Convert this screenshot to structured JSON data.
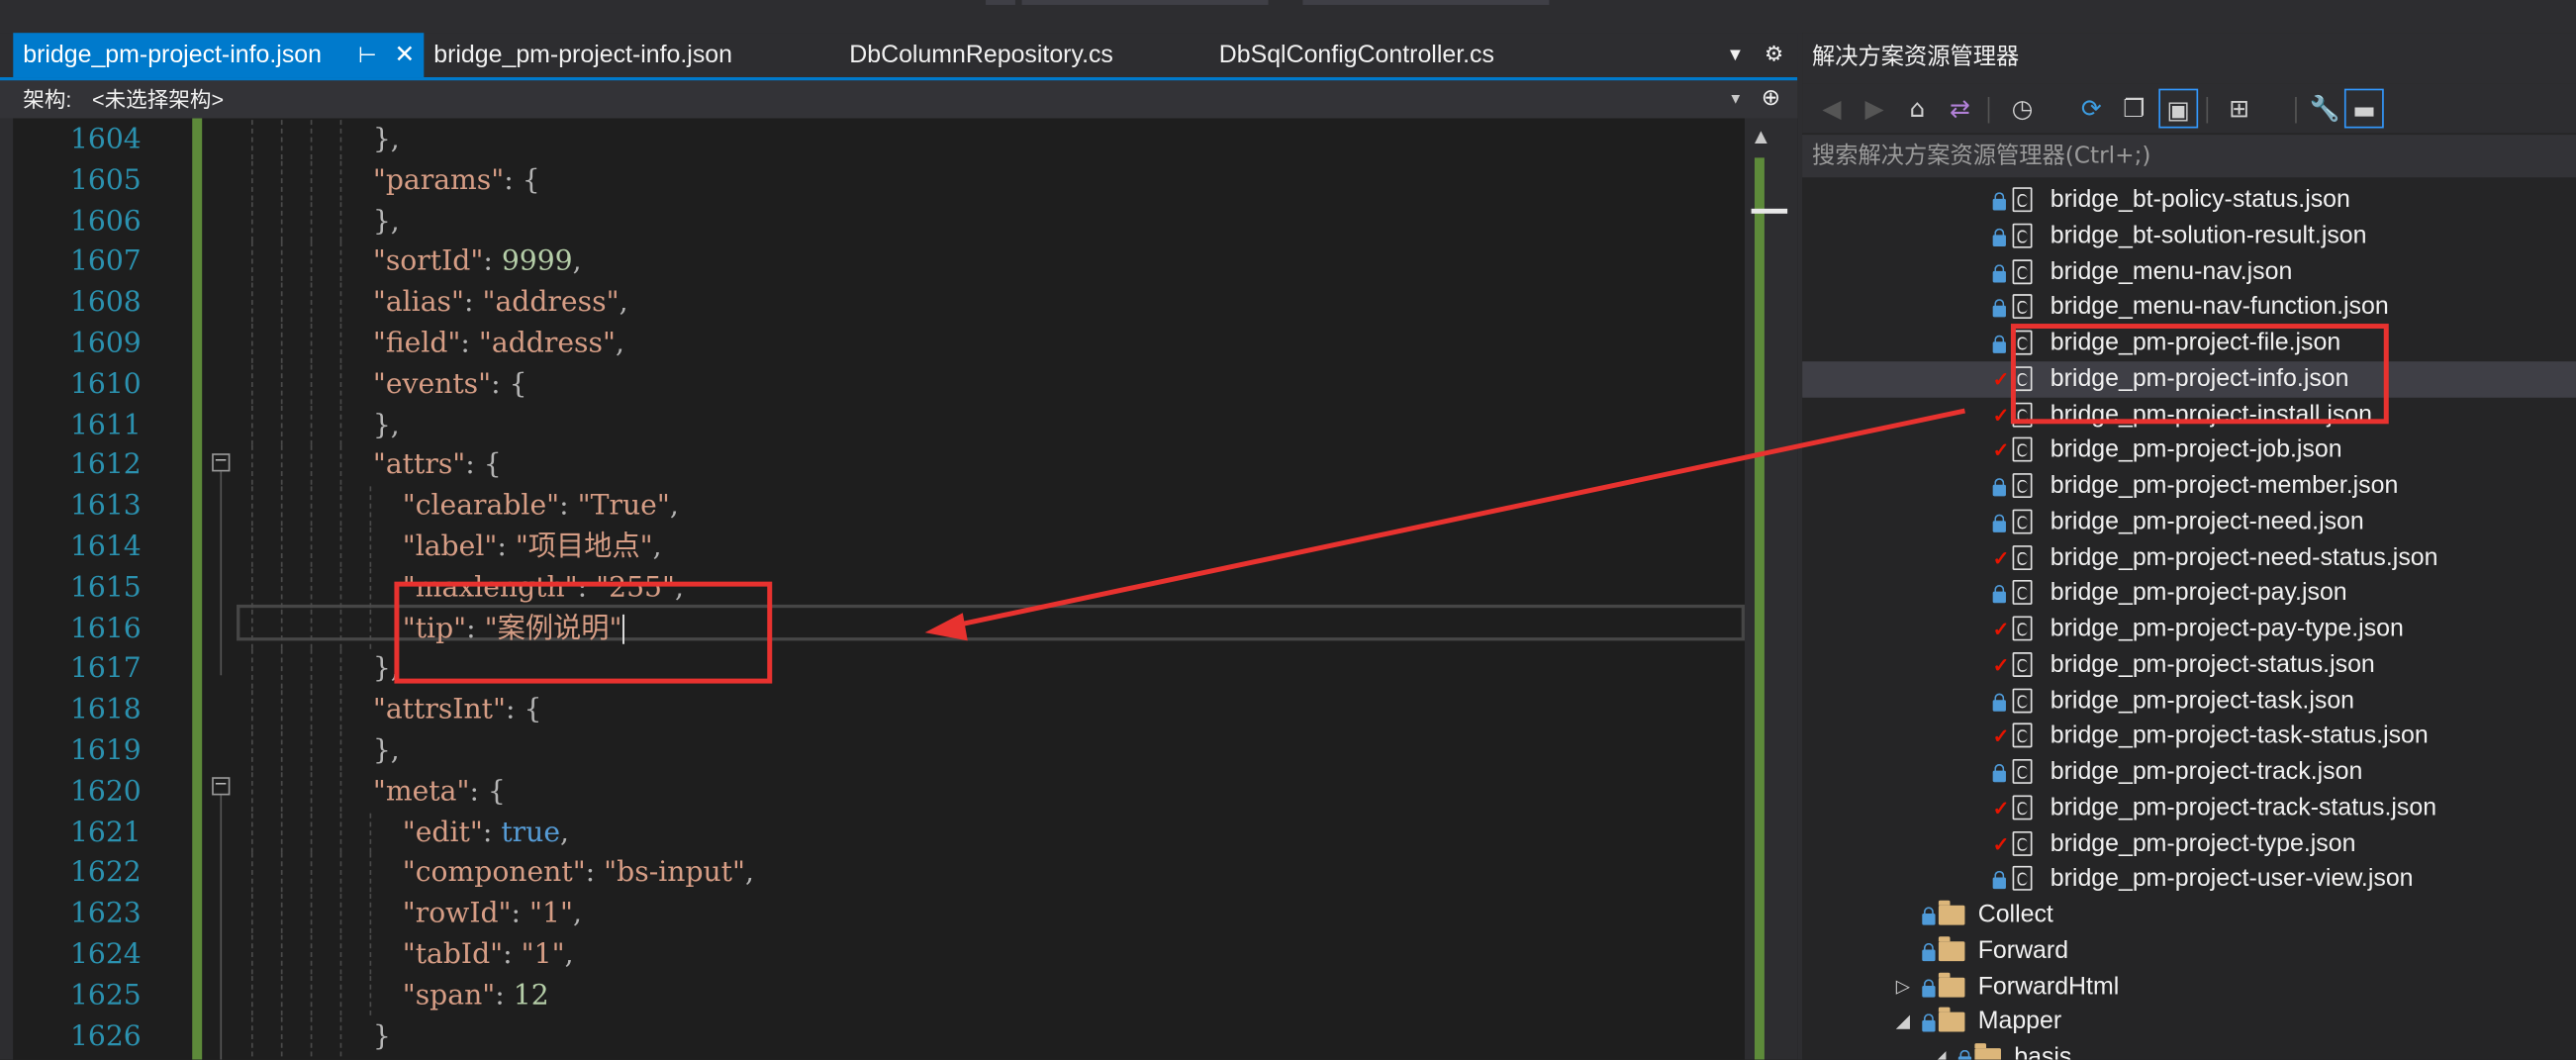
{
  "tabs": {
    "active": "bridge_pm-project-info.json",
    "active_pin": "⊢",
    "active_close": "✕",
    "others": [
      "bridge_pm-project-info.json",
      "DbColumnRepository.cs",
      "DbSqlConfigController.cs"
    ],
    "overflow_glyph": "▾",
    "settings_glyph": "⚙"
  },
  "schema": {
    "label": "架构:",
    "value": "<未选择架构>"
  },
  "editor": {
    "lines": [
      {
        "n": "1604",
        "t": "},"
      },
      {
        "n": "1605",
        "t": "\"params\": {"
      },
      {
        "n": "1606",
        "t": "},"
      },
      {
        "n": "1607",
        "t": "\"sortId\": 9999,"
      },
      {
        "n": "1608",
        "t": "\"alias\": \"address\","
      },
      {
        "n": "1609",
        "t": "\"field\": \"address\","
      },
      {
        "n": "1610",
        "t": "\"events\": {"
      },
      {
        "n": "1611",
        "t": "},"
      },
      {
        "n": "1612",
        "t": "\"attrs\": {"
      },
      {
        "n": "1613",
        "t": "\"clearable\": \"True\","
      },
      {
        "n": "1614",
        "t": "\"label\": \"项目地点\","
      },
      {
        "n": "1615",
        "t": "\"maxlength\": \"255\","
      },
      {
        "n": "1616",
        "t": "\"tip\": \"案例说明\""
      },
      {
        "n": "1617",
        "t": "},"
      },
      {
        "n": "1618",
        "t": "\"attrsInt\": {"
      },
      {
        "n": "1619",
        "t": "},"
      },
      {
        "n": "1620",
        "t": "\"meta\": {"
      },
      {
        "n": "1621",
        "t": "\"edit\": true,"
      },
      {
        "n": "1622",
        "t": "\"component\": \"bs-input\","
      },
      {
        "n": "1623",
        "t": "\"rowId\": \"1\","
      },
      {
        "n": "1624",
        "t": "\"tabId\": \"1\","
      },
      {
        "n": "1625",
        "t": "\"span\": 12"
      },
      {
        "n": "1626",
        "t": "}"
      }
    ]
  },
  "solution_explorer": {
    "title": "解决方案资源管理器",
    "search_placeholder": "搜索解决方案资源管理器(Ctrl+;)",
    "toolbar_icons": [
      "back-icon",
      "forward-icon",
      "home-icon",
      "switch-views-icon",
      "pending-changes-icon",
      "refresh-icon",
      "collapse-all-icon",
      "show-all-files-icon",
      "class-view-icon",
      "properties-icon",
      "preview-icon"
    ],
    "items": [
      {
        "label": "bridge_bt-policy-status.json",
        "status": "lock",
        "type": "file"
      },
      {
        "label": "bridge_bt-solution-result.json",
        "status": "lock",
        "type": "file"
      },
      {
        "label": "bridge_menu-nav.json",
        "status": "lock",
        "type": "file"
      },
      {
        "label": "bridge_menu-nav-function.json",
        "status": "lock",
        "type": "file"
      },
      {
        "label": "bridge_pm-project-file.json",
        "status": "lock",
        "type": "file"
      },
      {
        "label": "bridge_pm-project-info.json",
        "status": "check",
        "type": "file",
        "selected": true
      },
      {
        "label": "bridge_pm-project-install.json",
        "status": "check",
        "type": "file"
      },
      {
        "label": "bridge_pm-project-job.json",
        "status": "check",
        "type": "file"
      },
      {
        "label": "bridge_pm-project-member.json",
        "status": "lock",
        "type": "file"
      },
      {
        "label": "bridge_pm-project-need.json",
        "status": "lock",
        "type": "file"
      },
      {
        "label": "bridge_pm-project-need-status.json",
        "status": "check",
        "type": "file"
      },
      {
        "label": "bridge_pm-project-pay.json",
        "status": "lock",
        "type": "file"
      },
      {
        "label": "bridge_pm-project-pay-type.json",
        "status": "check",
        "type": "file"
      },
      {
        "label": "bridge_pm-project-status.json",
        "status": "check",
        "type": "file"
      },
      {
        "label": "bridge_pm-project-task.json",
        "status": "lock",
        "type": "file"
      },
      {
        "label": "bridge_pm-project-task-status.json",
        "status": "check",
        "type": "file"
      },
      {
        "label": "bridge_pm-project-track.json",
        "status": "lock",
        "type": "file"
      },
      {
        "label": "bridge_pm-project-track-status.json",
        "status": "check",
        "type": "file"
      },
      {
        "label": "bridge_pm-project-type.json",
        "status": "check",
        "type": "file"
      },
      {
        "label": "bridge_pm-project-user-view.json",
        "status": "lock",
        "type": "file"
      },
      {
        "label": "Collect",
        "status": "lock",
        "type": "folder"
      },
      {
        "label": "Forward",
        "status": "lock",
        "type": "folder"
      },
      {
        "label": "ForwardHtml",
        "status": "lock",
        "type": "folder",
        "expander": "▷"
      },
      {
        "label": "Mapper",
        "status": "lock",
        "type": "folder",
        "expander": "◢"
      },
      {
        "label": "basis",
        "status": "lock",
        "type": "folder",
        "expander": "◢"
      }
    ]
  },
  "colors": {
    "accent": "#007acc",
    "annotation_red": "#e8322f",
    "line_number": "#2b91af",
    "string": "#d69d85",
    "number": "#b5cea8",
    "keyword": "#569cd6",
    "change_bar": "#5d8a3a"
  }
}
